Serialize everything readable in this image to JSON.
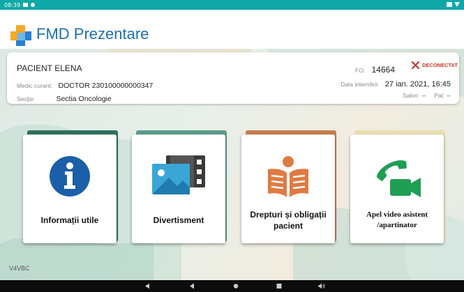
{
  "status_bar": {
    "time": "08:39"
  },
  "app": {
    "title": "FMD Prezentare"
  },
  "patient": {
    "name": "PACIENT ELENA",
    "fo_label": "FO:",
    "fo_value": "14664",
    "disconnect_label": "DECONECTAT",
    "doctor_label": "Medic curant:",
    "doctor_value": "DOCTOR 230100000000347",
    "admission_label": "Data internării:",
    "admission_value": "27 ian. 2021, 16:45",
    "section_label": "Secție:",
    "section_value": "Sectia Oncologie",
    "room_label": "Salon:",
    "room_value": "--",
    "bed_label": "Pat:",
    "bed_value": "--"
  },
  "tiles": [
    {
      "label": "Informații utile",
      "icon": "info-icon",
      "accent": "#2f6f5f"
    },
    {
      "label": "Divertisment",
      "icon": "media-icon",
      "accent": "#5a9a8a"
    },
    {
      "label": "Drepturi și obligații pacient",
      "icon": "reading-book-icon",
      "accent": "#c77d4e"
    },
    {
      "label": "Apel video asistent /apartinator",
      "icon": "video-call-icon",
      "accent": "#e9dfb0"
    }
  ],
  "footer": {
    "version": "V4VBC"
  },
  "colors": {
    "status_bar": "#0fa8a8",
    "brand_blue": "#1d6fb3",
    "info_blue": "#1b5fa8",
    "call_green": "#1f9e55",
    "book_orange": "#e07a43"
  }
}
